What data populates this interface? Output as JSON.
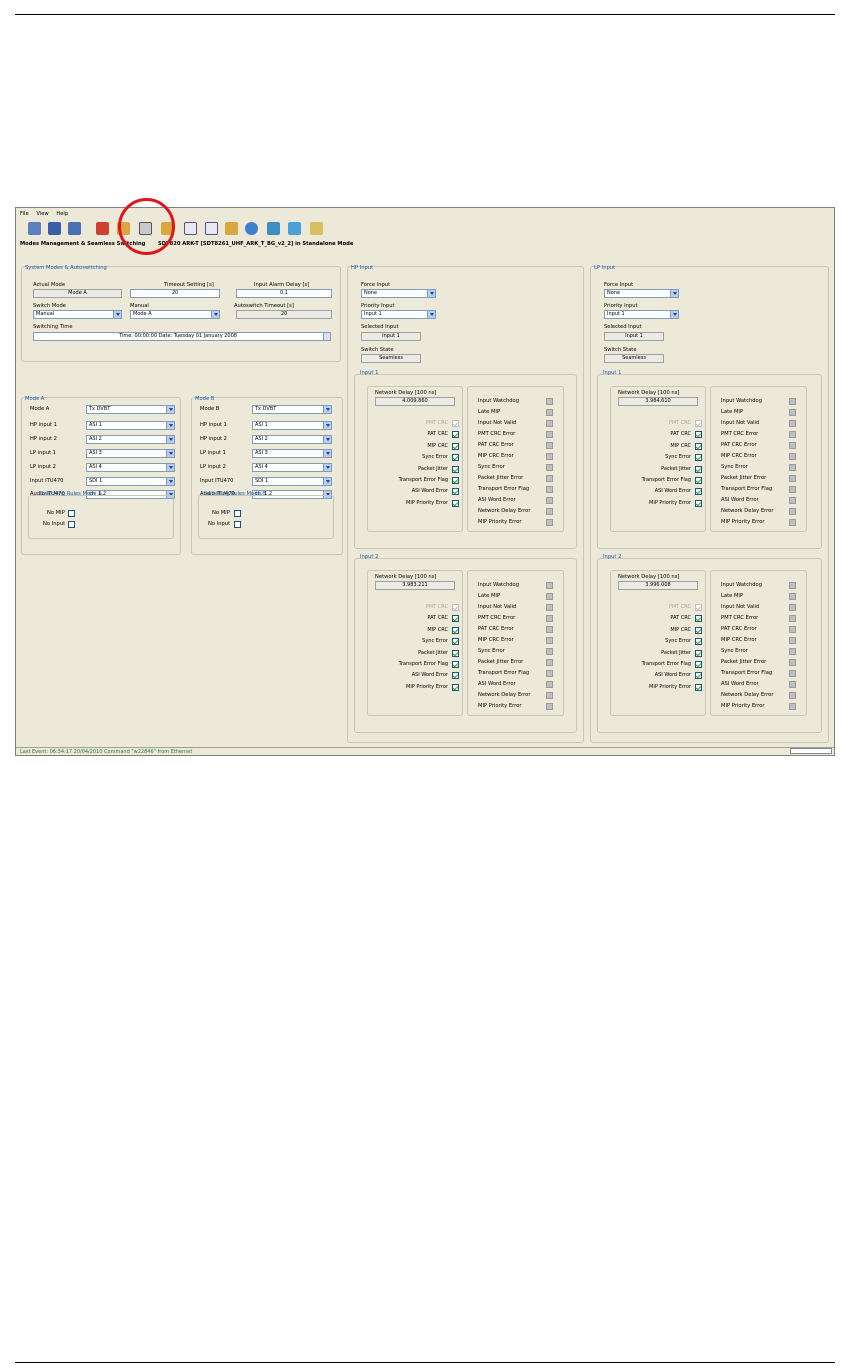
{
  "menu": [
    "File",
    "View",
    "Help"
  ],
  "title_prefix": "Modes Management & Seamless Switching",
  "title_main": "SDT820 ARK-T [SDT8261_UHF_ARK_T_BG_v2_2] in Standalone Mode",
  "system": {
    "title": "System Modes & Autoswitching",
    "actual_mode_label": "Actual Mode",
    "actual_mode": "Mode A",
    "timeout_label": "Timeout Setting [s]",
    "timeout": "20",
    "alarm_delay_label": "Input Alarm Delay [s]",
    "alarm_delay": "0,1",
    "switch_mode_label": "Switch Mode",
    "switch_mode": "Manual",
    "manual_label": "Manual",
    "manual": "Mode A",
    "autoswitch_label": "Autoswitch Timeout [s]",
    "autoswitch": "20",
    "switching_time_label": "Switching Time",
    "switching_time": "Time: 00:00:00   Date: Tuesday 01 January 2008"
  },
  "modeA": {
    "title": "Mode A",
    "rows": [
      {
        "label": "Mode A",
        "value": "Tx DVBT"
      },
      {
        "label": "HP input 1",
        "value": "ASI 1"
      },
      {
        "label": "HP input 2",
        "value": "ASI 2"
      },
      {
        "label": "LP input 1",
        "value": "ASI 3"
      },
      {
        "label": "LP input 2",
        "value": "ASI 4"
      },
      {
        "label": "Input ITU470",
        "value": "SDI 1"
      },
      {
        "label": "Audio ITU470",
        "value": "ch. 1,2"
      }
    ],
    "rules_title": "Switching Rules Mode A",
    "no_mip": "No MIP",
    "no_input": "No Input"
  },
  "modeB": {
    "title": "Mode B",
    "rows": [
      {
        "label": "Mode B",
        "value": "Tx DVBT"
      },
      {
        "label": "HP input 1",
        "value": "ASI 1"
      },
      {
        "label": "HP input 2",
        "value": "ASI 2"
      },
      {
        "label": "LP input 1",
        "value": "ASI 3"
      },
      {
        "label": "LP input 2",
        "value": "ASI 4"
      },
      {
        "label": "Input ITU470",
        "value": "SDI 1"
      },
      {
        "label": "Audio ITU470",
        "value": "ch. 1,2"
      }
    ],
    "rules_title": "Switching Rules Mode B",
    "no_mip": "No MIP",
    "no_input": "No Input"
  },
  "hp": {
    "title": "HP Input",
    "force_label": "Force Input",
    "force": "None",
    "priority_label": "Priority Input",
    "priority": "Input 1",
    "selected_label": "Selected Input",
    "selected": "Input 1",
    "state_label": "Switch State",
    "state": "Seamless",
    "in1": {
      "title": "Input 1",
      "delay": "4.009.860"
    },
    "in2": {
      "title": "Input 2",
      "delay": "3.983.211"
    }
  },
  "lp": {
    "title": "LP Input",
    "force_label": "Force Input",
    "force": "None",
    "priority_label": "Priority Input",
    "priority": "Input 1",
    "selected_label": "Selected Input",
    "selected": "Input 1",
    "state_label": "Switch State",
    "state": "Seamless",
    "in1": {
      "title": "Input 1",
      "delay": "3.984.610"
    },
    "in2": {
      "title": "Input 2",
      "delay": "3.996.008"
    }
  },
  "delay_label": "Network Delay [100 ns]",
  "check_labels": [
    "PMT CRC",
    "PAT CRC",
    "MIP CRC",
    "Sync Error",
    "Packet Jitter",
    "Transport Error Flag",
    "ASI Word Error",
    "MIP Priority Error"
  ],
  "alarm_labels": [
    "Input Watchdog",
    "Late MIP",
    "Input Not Valid",
    "PMT CRC Error",
    "PAT CRC Error",
    "MIP CRC Error",
    "Sync Error",
    "Packet Jitter Error",
    "Transport Error Flag",
    "ASI Word Error",
    "Network Delay Error",
    "MIP Priority Error"
  ],
  "status": "Last Event: 06:34:17 20/04/2010 Command \"w22846\" from Ethernet",
  "colors": {
    "highlight_circle": "#e0151b",
    "panel_title": "#2255aa",
    "status_text": "#2f7a2f"
  }
}
